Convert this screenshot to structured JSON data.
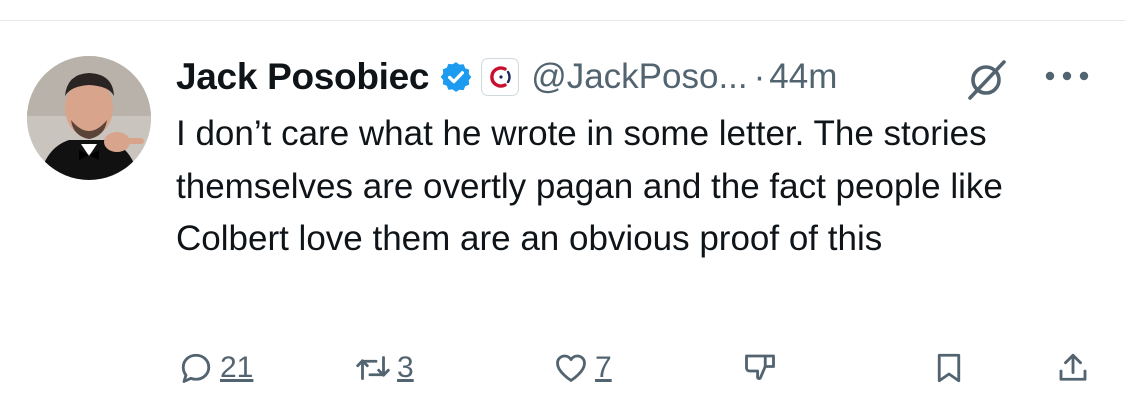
{
  "tweet": {
    "display_name": "Jack Posobiec",
    "handle": "@JackPoso...",
    "separator": "·",
    "time": "44m",
    "text": "I don’t care what he wrote in some letter. The stories themselves are overtly pagan and the fact people like Colbert love them are an obvious proof of this"
  },
  "actions": {
    "reply_count": "21",
    "retweet_count": "3",
    "like_count": "7"
  },
  "colors": {
    "verified": "#1d9bf0",
    "secondary_text": "#536471",
    "affiliate_red": "#c8102e",
    "affiliate_navy": "#1c2a5a"
  },
  "icons": [
    "verified-badge-icon",
    "affiliate-logo-icon",
    "grok-icon",
    "more-options-icon",
    "reply-icon",
    "retweet-icon",
    "like-icon",
    "dislike-icon",
    "bookmark-icon",
    "share-icon"
  ]
}
